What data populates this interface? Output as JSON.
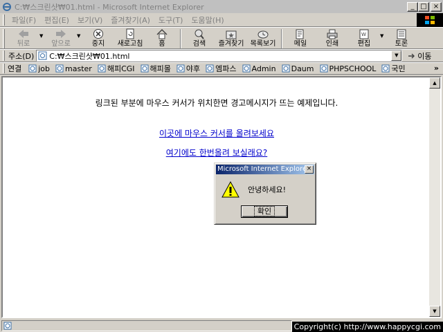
{
  "window": {
    "title": "C:₩스크린샷₩01.html - Microsoft Internet Explorer",
    "minimize": "_",
    "maximize": "□",
    "close": "×"
  },
  "menu": {
    "items": [
      {
        "label": "파일(F)"
      },
      {
        "label": "편집(E)"
      },
      {
        "label": "보기(V)"
      },
      {
        "label": "즐겨찾기(A)"
      },
      {
        "label": "도구(T)"
      },
      {
        "label": "도움말(H)"
      }
    ]
  },
  "toolbar": {
    "back": "뒤로",
    "forward": "앞으로",
    "stop": "중지",
    "refresh": "새로고침",
    "home": "홈",
    "search": "검색",
    "favorites": "즐겨찾기",
    "history": "목록보기",
    "mail": "메일",
    "print": "인쇄",
    "edit": "편집",
    "discuss": "토론"
  },
  "address": {
    "label": "주소(D)",
    "value": "C:₩스크린샷₩01.html",
    "go": "이동"
  },
  "links": {
    "label": "연결",
    "items": [
      {
        "label": "job"
      },
      {
        "label": "master"
      },
      {
        "label": "해피CGI"
      },
      {
        "label": "해피몰"
      },
      {
        "label": "야후"
      },
      {
        "label": "엠파스"
      },
      {
        "label": "Admin"
      },
      {
        "label": "Daum"
      },
      {
        "label": "PHPSCHOOL"
      },
      {
        "label": "국민"
      }
    ],
    "more": "»"
  },
  "page": {
    "message": "링크된 부분에 마우스 커서가 위치한면 경고메시지가 뜨는 예제입니다.",
    "link1": "이곳에 마우스 커서를 올려보세요",
    "link2": "여기에도 한번올려 보실래요?"
  },
  "dialog": {
    "title": "Microsoft Internet Explorer",
    "message": "안녕하세요!",
    "ok": "확인",
    "close": "×"
  },
  "status": {
    "copyright": "Copyright(c) http://www.happycgi.com"
  },
  "colors": {
    "chrome": "#d4d0c8",
    "link": "#0000cc",
    "dialog_title_start": "#0a246a",
    "dialog_title_end": "#a6caf0"
  }
}
